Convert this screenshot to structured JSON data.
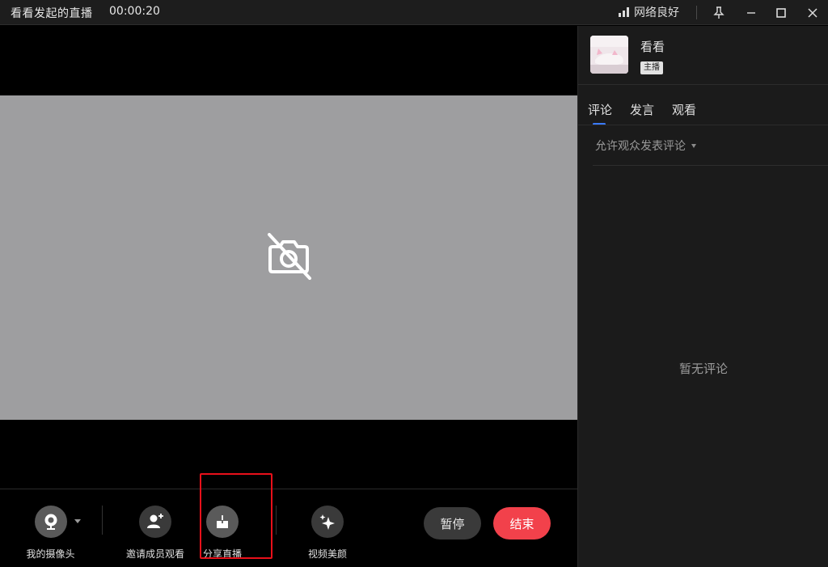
{
  "window": {
    "title": "看看发起的直播",
    "elapsed": "00:00:20",
    "network_status": "网络良好",
    "icons": [
      "signal-icon",
      "pin-icon",
      "minimize-icon",
      "maximize-icon",
      "close-icon"
    ]
  },
  "video": {
    "camera_state_icon": "camera-off-icon",
    "frame_color": "#9e9ea0"
  },
  "toolbar": {
    "camera_label": "我的摄像头",
    "invite_label": "邀请成员观看",
    "share_label": "分享直播",
    "beauty_label": "视频美颜",
    "pause_label": "暂停",
    "end_label": "结束",
    "end_color": "#f2414b"
  },
  "sidebar": {
    "host_name": "看看",
    "host_badge": "主播",
    "tabs": [
      {
        "label": "评论",
        "active": true
      },
      {
        "label": "发言",
        "active": false
      },
      {
        "label": "观看",
        "active": false
      }
    ],
    "comment_permission": "允许观众发表评论",
    "empty_state": "暂无评论",
    "accent_color": "#3a7bff"
  }
}
